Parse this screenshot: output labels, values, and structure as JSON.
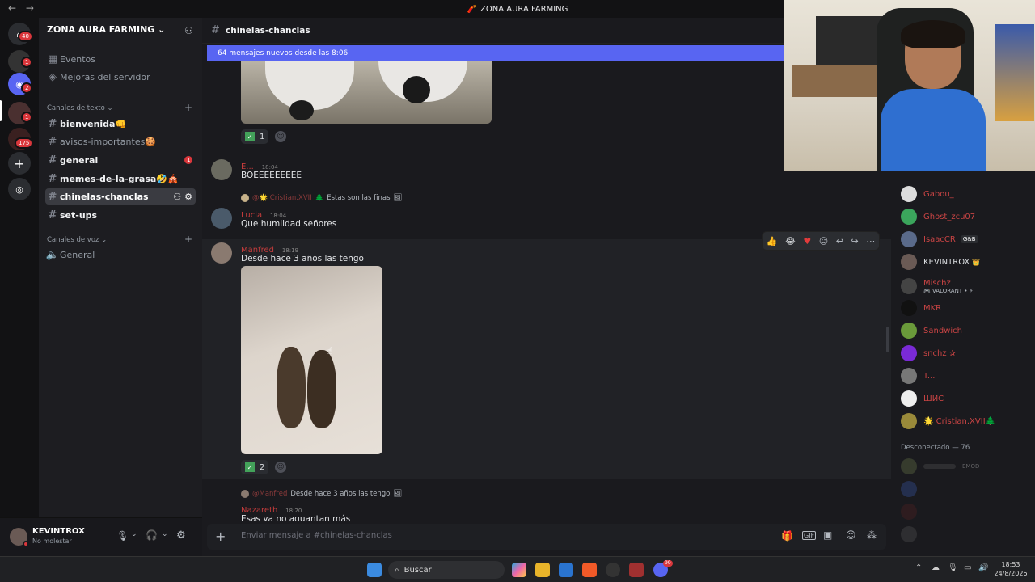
{
  "window": {
    "title": "ZONA AURA FARMING"
  },
  "servers": {
    "badges": [
      "40",
      "1",
      "2",
      "1",
      "175"
    ]
  },
  "sidebar": {
    "server_name": "ZONA AURA FARMING",
    "top_items": [
      {
        "label": "Eventos"
      },
      {
        "label": "Mejoras del servidor"
      }
    ],
    "text_category": "Canales de texto",
    "text_channels": [
      {
        "label": "bienvenida👊"
      },
      {
        "label": "avisos-importantes🍪"
      },
      {
        "label": "general",
        "badge": "1"
      },
      {
        "label": "memes-de-la-grasa🤣🎪"
      },
      {
        "label": "chinelas-chanclas"
      },
      {
        "label": "set-ups"
      }
    ],
    "voice_category": "Canales de voz",
    "voice_channels": [
      {
        "label": "General"
      }
    ]
  },
  "user": {
    "name": "KEVINTROX",
    "status": "No molestar"
  },
  "chat": {
    "channel": "chinelas-chanclas",
    "new_messages": "64 mensajes nuevos desde las 8:06",
    "first_reaction_count": "1",
    "msg_e": {
      "author": "E...",
      "time": "18:04",
      "text": "BOEEEEEEEEE"
    },
    "reply1": {
      "author": "@🌟 Cristian.XVII",
      "preview": "Estas son las finas"
    },
    "msg_lucia": {
      "author": "Lucia",
      "time": "18:04",
      "text": "Que humildad señores"
    },
    "msg_manfred": {
      "author": "Manfred",
      "time": "18:19",
      "text": "Desde hace 3 años las tengo",
      "reaction_count": "2"
    },
    "reply2": {
      "author": "@Manfred",
      "preview": "Desde hace 3 años las tengo"
    },
    "msg_naz": {
      "author": "Nazareth",
      "time": "18:20",
      "text": "Esas ya no aguantan más"
    },
    "composer_placeholder": "Enviar mensaje a #chinelas-chanclas"
  },
  "members": {
    "online": [
      {
        "name": "Gabou_",
        "color": "#c94444"
      },
      {
        "name": "Ghost_zcu07",
        "color": "#c94444"
      },
      {
        "name": "IsaacCR",
        "tag": "G&B",
        "color": "#c94444"
      },
      {
        "name": "KEVINTROX",
        "crown": "👑",
        "color": "#dbdee1"
      },
      {
        "name": "Mischz",
        "activity": "🎮 VALORANT • ⚡",
        "color": "#c94444"
      },
      {
        "name": "MKR",
        "color": "#c94444"
      },
      {
        "name": "Sandwich",
        "color": "#c94444"
      },
      {
        "name": "snchz ✰",
        "color": "#c94444"
      },
      {
        "name": "T...",
        "color": "#c94444"
      },
      {
        "name": "ШИС",
        "color": "#c94444"
      },
      {
        "name": "🌟 Cristian.XVII🌲",
        "color": "#c94444"
      }
    ],
    "offline_header": "Desconectado — 76",
    "offline_tag": "EMOD"
  },
  "taskbar": {
    "search": "Buscar",
    "time": "18:53",
    "date": "24/8/2026",
    "notif_badge": "99"
  }
}
